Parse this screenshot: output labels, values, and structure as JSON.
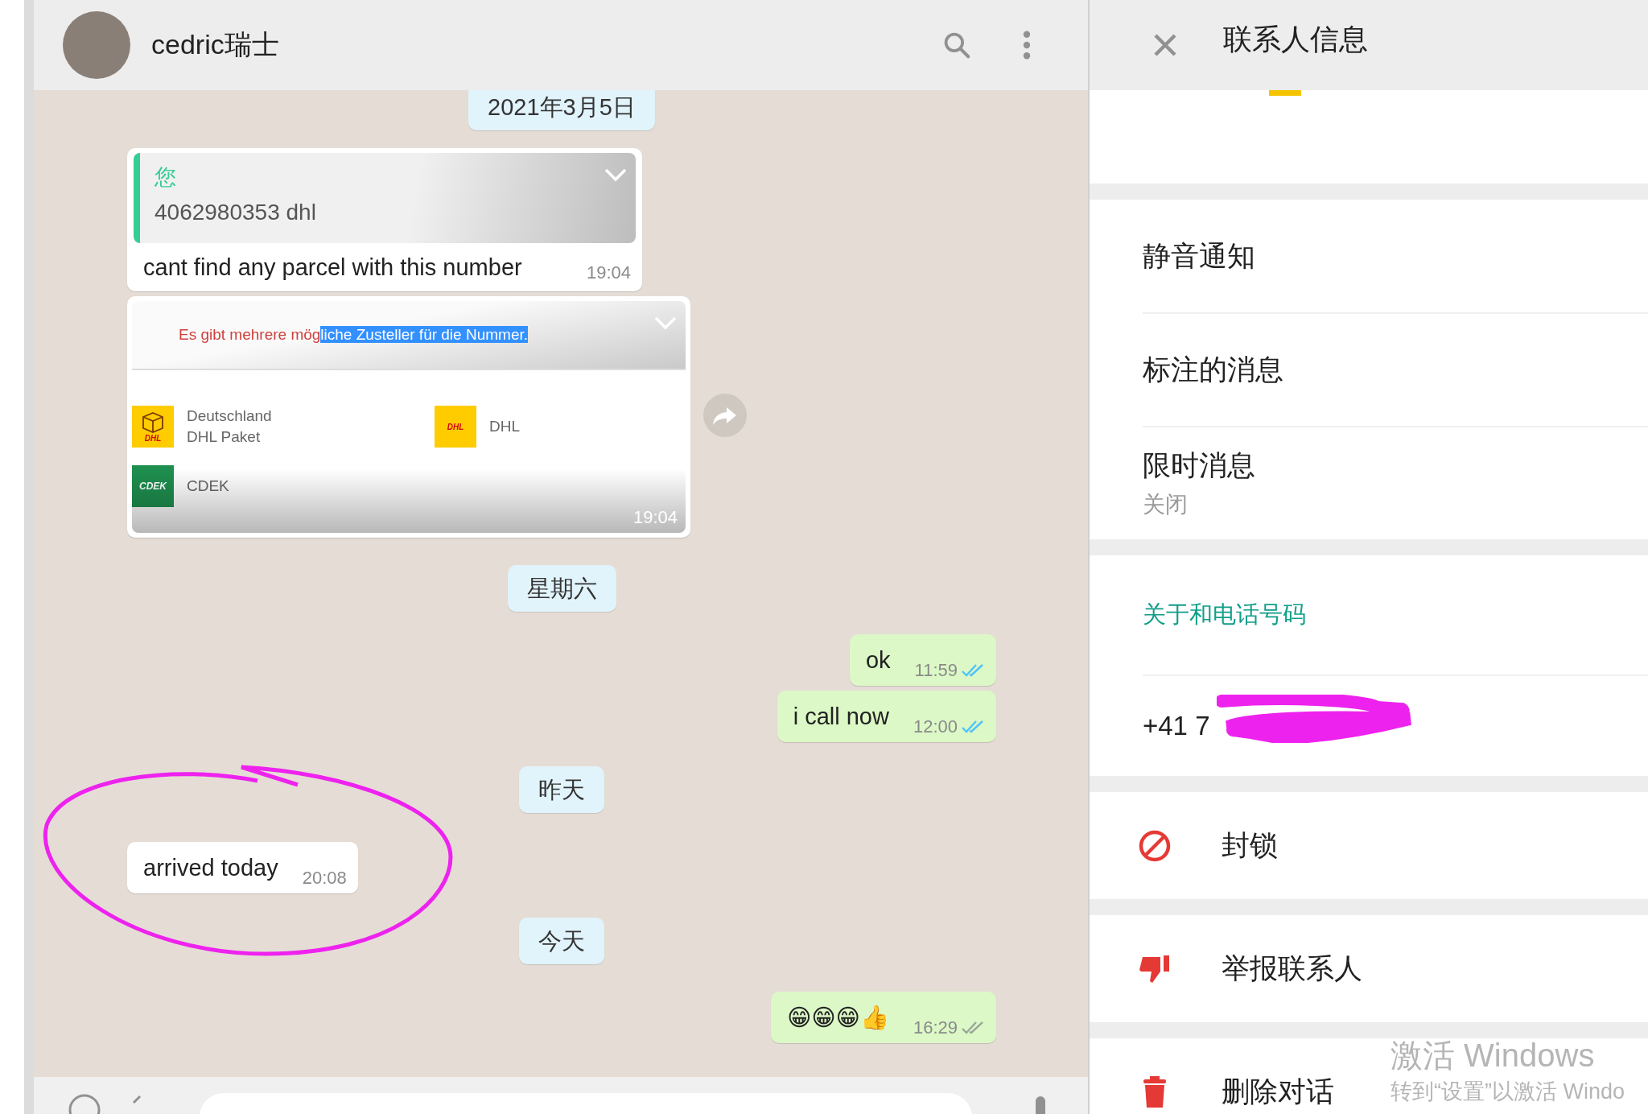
{
  "chat_header": {
    "contact_name": "cedric瑞士"
  },
  "messages": [
    {
      "kind": "date",
      "text": "2021年3月5日"
    },
    {
      "kind": "quoted",
      "outgoing": false,
      "quote_author": "您",
      "quote_text": "4062980353 dhl",
      "text": "cant find any parcel with this number",
      "time": "19:04"
    },
    {
      "kind": "card",
      "outgoing": false,
      "heading": "Es gibt mehrere mög",
      "heading_selected": "liche Zusteller für die Nummer.",
      "carriers": [
        {
          "kind": "dhl-parcel",
          "logo_text": "DHL",
          "name": "Deutschland\nDHL Paket"
        },
        {
          "kind": "dhl",
          "logo_text": "DHL",
          "name": "DHL"
        },
        {
          "kind": "cdek",
          "logo_text": "CDEK",
          "name": "CDEK"
        }
      ],
      "time": "19:04"
    },
    {
      "kind": "date",
      "text": "星期六"
    },
    {
      "kind": "text",
      "outgoing": true,
      "text": "ok",
      "time": "11:59",
      "read": true
    },
    {
      "kind": "text",
      "outgoing": true,
      "text": "i call now",
      "time": "12:00",
      "read": true
    },
    {
      "kind": "date",
      "text": "昨天"
    },
    {
      "kind": "text",
      "outgoing": false,
      "text": "arrived today",
      "time": "20:08"
    },
    {
      "kind": "date",
      "text": "今天"
    },
    {
      "kind": "text",
      "outgoing": true,
      "text": "😁😁😁👍",
      "time": "16:29",
      "read": false
    }
  ],
  "contact_info": {
    "title": "联系人信息",
    "settings": [
      {
        "label": "静音通知"
      },
      {
        "label": "标注的消息"
      },
      {
        "label": "限时消息",
        "value": "关闭"
      }
    ],
    "about": {
      "heading": "关于和电话号码",
      "phone": "+41 7"
    },
    "actions": [
      {
        "kind": "block",
        "label": "封锁"
      },
      {
        "kind": "report",
        "label": "举报联系人"
      },
      {
        "kind": "delete",
        "label": "删除对话"
      }
    ]
  },
  "os_watermark": {
    "title": "激活 Windows",
    "subtitle": "转到“设置”以激活 Windo"
  }
}
